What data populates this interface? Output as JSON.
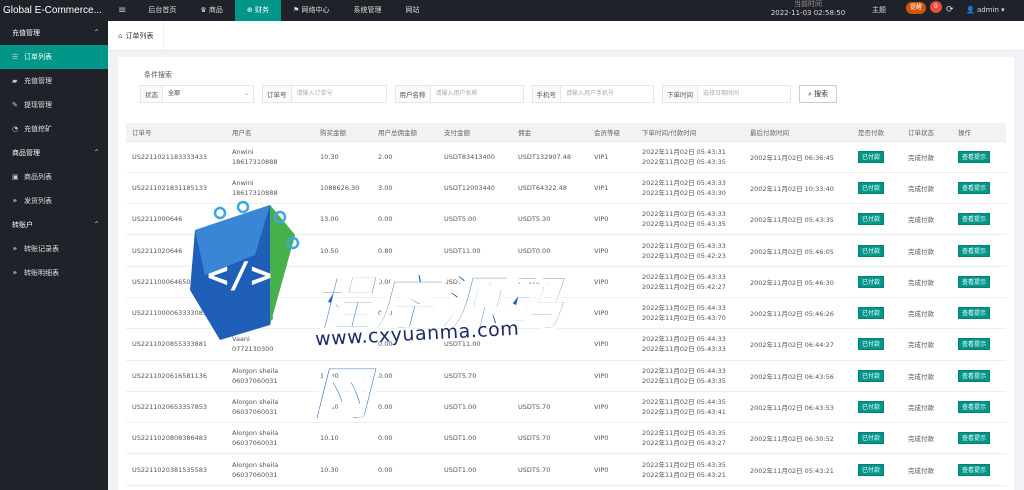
{
  "topbar": {
    "brand": "Global E-Commerce...",
    "nav": [
      {
        "icon": "≡",
        "label": ""
      },
      {
        "icon": "",
        "label": "后台首页"
      },
      {
        "icon": "♛",
        "label": "商品"
      },
      {
        "icon": "⊕",
        "label": "财务"
      },
      {
        "icon": "⚑",
        "label": "网络中心"
      },
      {
        "icon": "",
        "label": "系统管理"
      },
      {
        "icon": "",
        "label": "网站"
      }
    ],
    "clock_title": "当前时间",
    "clock_time": "2022-11-03 02:58:50",
    "mode": "主题",
    "alert_badge": "提醒",
    "counter_badge": "0",
    "refresh_icon": "refresh-icon",
    "user": "admin"
  },
  "sidebar": {
    "groups": [
      {
        "label": "充值管理",
        "items": [
          {
            "label": "订单列表",
            "icon": "list-icon",
            "active": true
          },
          {
            "label": "充值管理",
            "icon": "chat-icon",
            "active": false
          },
          {
            "label": "提现管理",
            "icon": "wrench-icon",
            "active": false
          },
          {
            "label": "充值挖矿",
            "icon": "dashboard-icon",
            "active": false
          }
        ]
      },
      {
        "label": "商品管理",
        "items": [
          {
            "label": "商品列表",
            "icon": "cart-icon",
            "active": false
          },
          {
            "label": "发货列表",
            "icon": "link-icon",
            "active": false
          }
        ]
      },
      {
        "label": "转账户",
        "items": [
          {
            "label": "转账记录表",
            "icon": "link-icon",
            "active": false
          },
          {
            "label": "转账明细表",
            "icon": "link-icon",
            "active": false
          }
        ]
      }
    ]
  },
  "tabs": [
    {
      "label": "订单列表",
      "icon": "home-icon"
    }
  ],
  "filter": {
    "title": "条件搜索",
    "fields": [
      {
        "label": "状态",
        "value": "全部",
        "type": "select"
      },
      {
        "label": "订单号",
        "placeholder": "请输入订单号",
        "type": "input"
      },
      {
        "label": "用户名称",
        "placeholder": "请输入用户名称",
        "type": "input"
      },
      {
        "label": "手机号",
        "placeholder": "请输入用户手机号",
        "type": "input"
      },
      {
        "label": "下单时间",
        "placeholder": "选择日期时间",
        "type": "input"
      }
    ],
    "search_label": "搜索"
  },
  "table": {
    "columns": [
      "订单号",
      "用户名",
      "购买金额",
      "用户总佣金额",
      "支付金额",
      "佣金",
      "会员等级",
      "下单时间/付款时间",
      "最后付款时间",
      "是否付款",
      "订单状态",
      "操作"
    ],
    "rows": [
      {
        "order": "US2211021183333433",
        "user": [
          "Anwini",
          "18617310888"
        ],
        "amount": "10.30",
        "commission_total": "2.00",
        "pay": "USDT83413400",
        "commission": "USDT132907.48",
        "level": "VIP1",
        "time": [
          "2022年11月02日 05:43:31",
          "2022年11月02日 05:43:35"
        ],
        "last": "2002年11月02日 06:36:45",
        "paid": "已付款",
        "status": "完成付款",
        "op": "查看提示"
      },
      {
        "order": "US2211021831185133",
        "user": [
          "Anwini",
          "18617310888"
        ],
        "amount": "1088626.30",
        "commission_total": "3.00",
        "pay": "USDT12003440",
        "commission": "USDT64322.48",
        "level": "VIP1",
        "time": [
          "2022年11月02日 05:43:33",
          "2022年11月02日 05:43:30"
        ],
        "last": "2002年11月02日 10:33:40",
        "paid": "已付款",
        "status": "完成付款",
        "op": "查看提示"
      },
      {
        "order": "US2211000646",
        "user": [
          "",
          ""
        ],
        "amount": "13.00",
        "commission_total": "0.00",
        "pay": "USDT5.00",
        "commission": "USDT5.30",
        "level": "VIP0",
        "time": [
          "2022年11月02日 05:43:33",
          "2022年11月02日 05:43:35"
        ],
        "last": "2002年11月02日 05:43:35",
        "paid": "已付款",
        "status": "完成付款",
        "op": "查看提示"
      },
      {
        "order": "US2211020646",
        "user": [
          "",
          ""
        ],
        "amount": "10.50",
        "commission_total": "0.80",
        "pay": "USDT11.00",
        "commission": "USDT0.00",
        "level": "VIP0",
        "time": [
          "2022年11月02日 05:43:33",
          "2022年11月02日 05:42:23"
        ],
        "last": "2002年11月02日 05:46:05",
        "paid": "已付款",
        "status": "完成付款",
        "op": "查看提示"
      },
      {
        "order": "US2211000646500",
        "user": [
          "",
          ""
        ],
        "amount": "",
        "commission_total": "0.00",
        "pay": "USDT0.70",
        "commission": "USDT0.00",
        "level": "VIP0",
        "time": [
          "2022年11月02日 05:43:33",
          "2022年11月02日 05:42:27"
        ],
        "last": "2002年11月02日 05:46:30",
        "paid": "已付款",
        "status": "完成付款",
        "op": "查看提示"
      },
      {
        "order": "US2211000063333085",
        "user": [
          "Vaani",
          "0772130300"
        ],
        "amount": "",
        "commission_total": "0.00",
        "pay": "",
        "commission": "",
        "level": "VIP0",
        "time": [
          "2022年11月02日 05:44:33",
          "2022年11月02日 05:43:70"
        ],
        "last": "2002年11月02日 05:46:26",
        "paid": "已付款",
        "status": "完成付款",
        "op": "查看提示"
      },
      {
        "order": "US2211020855333881",
        "user": [
          "Vaani",
          "0772130300"
        ],
        "amount": "",
        "commission_total": "0.00",
        "pay": "USDT11.00",
        "commission": "",
        "level": "VIP0",
        "time": [
          "2022年11月02日 05:44:33",
          "2022年11月02日 05:43:33"
        ],
        "last": "2002年11月02日 06:44:27",
        "paid": "已付款",
        "status": "完成付款",
        "op": "查看提示"
      },
      {
        "order": "US2211020616581136",
        "user": [
          "Alorgon sheila",
          "06037060031"
        ],
        "amount": "10.30",
        "commission_total": "0.00",
        "pay": "USDT5.70",
        "commission": "",
        "level": "VIP0",
        "time": [
          "2022年11月02日 05:44:33",
          "2022年11月02日 05:43:35"
        ],
        "last": "2002年11月02日 06:43:56",
        "paid": "已付款",
        "status": "完成付款",
        "op": "查看提示"
      },
      {
        "order": "US2211020653357853",
        "user": [
          "Alorgon sheila",
          "06037060031"
        ],
        "amount": "10.30",
        "commission_total": "0.00",
        "pay": "USDT1.00",
        "commission": "USDT5.70",
        "level": "VIP0",
        "time": [
          "2022年11月02日 05:44:35",
          "2022年11月02日 05:43:41"
        ],
        "last": "2002年11月02日 06:43:53",
        "paid": "已付款",
        "status": "完成付款",
        "op": "查看提示"
      },
      {
        "order": "US2211020808386483",
        "user": [
          "Alorgon sheila",
          "06037060031"
        ],
        "amount": "10.10",
        "commission_total": "0.00",
        "pay": "USDT1.00",
        "commission": "USDT5.70",
        "level": "VIP0",
        "time": [
          "2022年11月02日 05:43:35",
          "2022年11月02日 05:43:27"
        ],
        "last": "2002年11月02日 06:30:52",
        "paid": "已付款",
        "status": "完成付款",
        "op": "查看提示"
      },
      {
        "order": "US2211020381535583",
        "user": [
          "Alorgon sheila",
          "06037060031"
        ],
        "amount": "10.30",
        "commission_total": "0.00",
        "pay": "USDT1.00",
        "commission": "USDT5.70",
        "level": "VIP0",
        "time": [
          "2022年11月02日 05:43:35",
          "2022年11月02日 05:43:21"
        ],
        "last": "2002年11月02日 05:43:21",
        "paid": "已付款",
        "status": "完成付款",
        "op": "查看提示"
      }
    ]
  },
  "watermark": {
    "title": "程序源码网",
    "url": "www.cxyuanma.com",
    "logo_text": "</>"
  }
}
